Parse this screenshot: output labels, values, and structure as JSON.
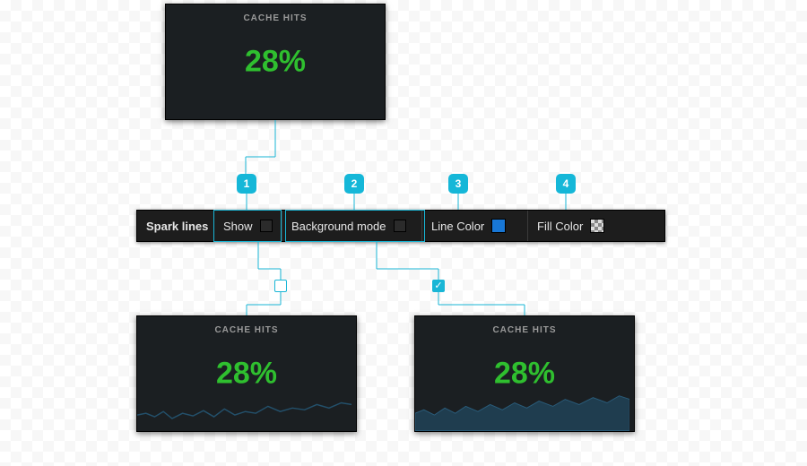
{
  "cards": {
    "top": {
      "title": "CACHE HITS",
      "value": "28%"
    },
    "bl": {
      "title": "CACHE HITS",
      "value": "28%"
    },
    "br": {
      "title": "CACHE HITS",
      "value": "28%"
    }
  },
  "toolbar": {
    "title": "Spark lines",
    "show": {
      "label": "Show",
      "checked": false
    },
    "bg": {
      "label": "Background mode",
      "checked": false
    },
    "line": {
      "label": "Line Color",
      "color": "#1877d6"
    },
    "fill": {
      "label": "Fill Color",
      "color": "checker"
    }
  },
  "markers": {
    "m1": "1",
    "m2": "2",
    "m3": "3",
    "m4": "4"
  },
  "mini": {
    "off": "",
    "on": "✓"
  },
  "colors": {
    "accent": "#15b7d8",
    "value": "#2fbf2f",
    "panel": "#1b1f22"
  }
}
